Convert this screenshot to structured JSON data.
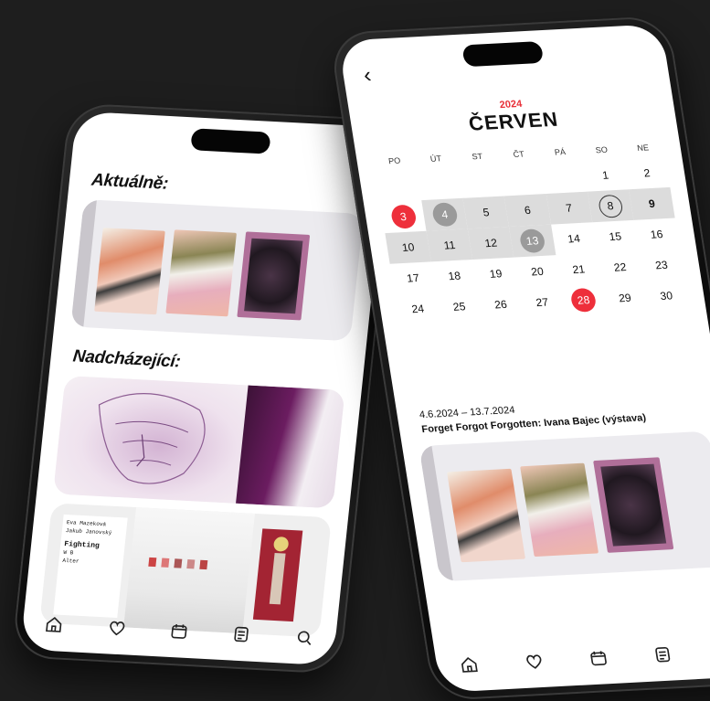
{
  "left_phone": {
    "current_heading": "Aktuálně:",
    "upcoming_heading": "Nadcházející:",
    "exhibit_poster_lines": [
      "Eva Mazeková",
      "Jakub Janovský",
      "Fighting",
      "W B",
      "Alter"
    ]
  },
  "right_phone": {
    "back_glyph": "‹",
    "year": "2024",
    "month": "ČERVEN",
    "weekdays": [
      "PO",
      "ÚT",
      "ST",
      "ČT",
      "PÁ",
      "SO",
      "NE"
    ],
    "weeks": [
      [
        "",
        "",
        "",
        "",
        "",
        "1",
        "2"
      ],
      [
        "3",
        "4",
        "5",
        "6",
        "7",
        "8",
        "9"
      ],
      [
        "10",
        "11",
        "12",
        "13",
        "14",
        "15",
        "16"
      ],
      [
        "17",
        "18",
        "19",
        "20",
        "21",
        "22",
        "23"
      ],
      [
        "24",
        "25",
        "26",
        "27",
        "28",
        "29",
        "30"
      ]
    ],
    "event_range": "4.6.2024 – 13.7.2024",
    "event_title": "Forget Forgot Forgotten: Ivana Bajec (výstava)"
  },
  "nav_items": [
    "home-icon",
    "heart-icon",
    "calendar-icon",
    "news-icon",
    "search-icon"
  ],
  "colors": {
    "accent": "#ee2f3b",
    "grey_marker": "#9a9a9a",
    "band": "#dcdcdc",
    "background": "#1e1e1e"
  }
}
